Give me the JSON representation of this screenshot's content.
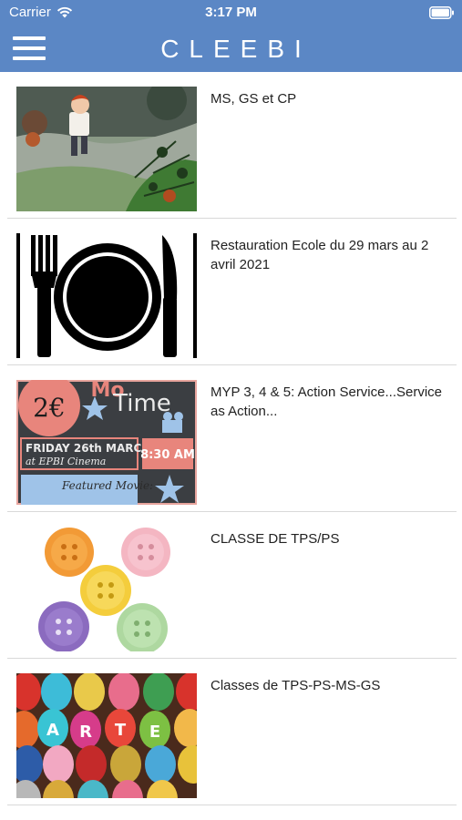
{
  "status_bar": {
    "carrier": "Carrier",
    "time": "3:17 PM",
    "wifi_icon": "wifi-icon",
    "battery_icon": "battery-icon"
  },
  "header": {
    "title": "CLEEBI",
    "menu_icon": "hamburger-menu-icon",
    "background_color": "#5b87c5"
  },
  "articles": [
    {
      "title": "MS, GS et CP",
      "thumbnail": "illustration of a child walking on a path in a forest"
    },
    {
      "title": "Restauration Ecole du 29 mars au 2 avril 2021",
      "thumbnail": "fork, plate and knife icon"
    },
    {
      "title": "MYP 3, 4 & 5: Action Service...Service as Action...",
      "thumbnail": "movie time poster on blackboard"
    },
    {
      "title": "CLASSE DE TPS/PS",
      "thumbnail": "colorful buttons"
    },
    {
      "title": "Classes de TPS-PS-MS-GS",
      "thumbnail": "painted easter eggs"
    }
  ],
  "poster": {
    "price": "2€",
    "line1": "Mo",
    "line2": "Time",
    "date": "FRIDAY 26th MARCH",
    "venue": "at EPBI Cinema",
    "time": "8:30 AM",
    "featured": "Featured Movie:"
  },
  "eggs": {
    "letters": [
      "A",
      "R",
      "T",
      "E"
    ]
  }
}
